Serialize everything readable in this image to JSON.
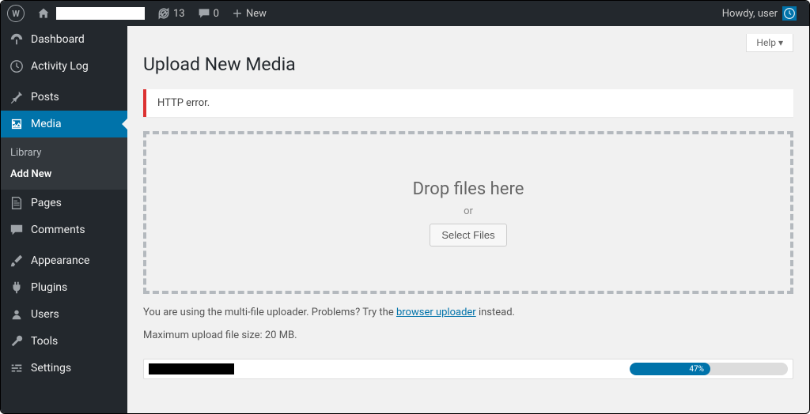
{
  "adminbar": {
    "site_label": "",
    "updates_count": "13",
    "comments_count": "0",
    "new_label": "New",
    "howdy": "Howdy, user"
  },
  "sidebar": {
    "items": [
      {
        "icon": "dashboard",
        "label": "Dashboard"
      },
      {
        "icon": "clock",
        "label": "Activity Log"
      },
      {
        "icon": "pin",
        "label": "Posts"
      },
      {
        "icon": "media",
        "label": "Media",
        "current": true
      },
      {
        "icon": "page",
        "label": "Pages"
      },
      {
        "icon": "comment",
        "label": "Comments"
      },
      {
        "icon": "brush",
        "label": "Appearance"
      },
      {
        "icon": "plug",
        "label": "Plugins"
      },
      {
        "icon": "users",
        "label": "Users"
      },
      {
        "icon": "wrench",
        "label": "Tools"
      },
      {
        "icon": "sliders",
        "label": "Settings"
      }
    ],
    "submenu": [
      {
        "label": "Library"
      },
      {
        "label": "Add New",
        "current": true
      }
    ]
  },
  "page": {
    "help_label": "Help",
    "title": "Upload New Media",
    "error_message": "HTTP error.",
    "dropzone_title": "Drop files here",
    "dropzone_or": "or",
    "select_files_label": "Select Files",
    "hint_prefix": "You are using the multi-file uploader. Problems? Try the ",
    "hint_link": "browser uploader",
    "hint_suffix": " instead.",
    "max_size": "Maximum upload file size: 20 MB.",
    "upload_progress_pct": 47,
    "upload_progress_label": "47%"
  }
}
